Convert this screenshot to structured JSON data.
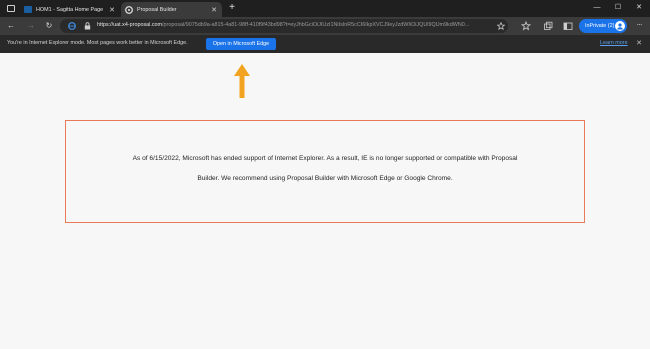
{
  "tabs": [
    {
      "title": "HOM1 - Sagitta Home Page",
      "active": false
    },
    {
      "title": "Proposal Builder",
      "active": true
    }
  ],
  "address_bar": {
    "url_host": "https://uat.x4-proposal.com",
    "url_rest": "/proposal/9075db9a-a815-4a81-98ff-410f9f43bd98?t=eyJhbGciOiJIUzI1NiIsInR5cCI6IkpXVCJ9eyJzdWIiOiJQUl9QUm9kdWN0..."
  },
  "profile": {
    "label": "InPrivate (2)"
  },
  "infobar": {
    "message": "You're in Internet Explorer mode. Most pages work better in Microsoft Edge.",
    "button_label": "Open in Microsoft Edge",
    "link_label": "Learn more"
  },
  "notice": {
    "line1": "As of 6/15/2022, Microsoft has ended support of Internet Explorer. As a result, IE is no longer supported or compatible with Proposal",
    "line2": "Builder. We recommend using Proposal Builder with Microsoft Edge or Google Chrome."
  },
  "colors": {
    "accent": "#1a73e8",
    "arrow": "#f2a31f",
    "notice_border": "#e87a5a",
    "chrome_dark": "#1f1f1f"
  },
  "icons": [
    "tab-actions-icon",
    "sagitta-favicon",
    "edge-favicon",
    "close-icon",
    "new-tab-icon",
    "minimize-icon",
    "maximize-icon",
    "back-icon",
    "forward-icon",
    "refresh-icon",
    "ie-mode-icon",
    "lock-icon",
    "star-icon",
    "favorites-icon",
    "collections-icon",
    "more-icon",
    "arrow-up-icon"
  ]
}
